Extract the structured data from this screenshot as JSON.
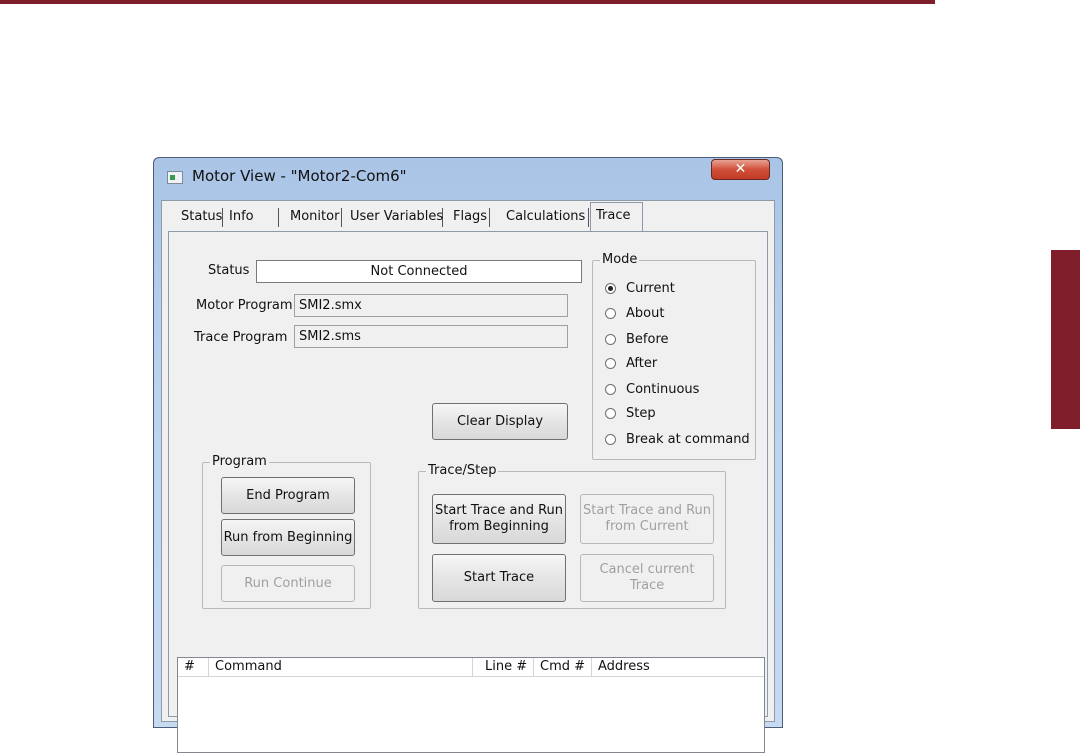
{
  "window": {
    "title": "Motor View - \"Motor2-Com6\"",
    "close_glyph": "✕"
  },
  "tabs": [
    {
      "label": "Status"
    },
    {
      "label": "Info"
    },
    {
      "label": "Monitor"
    },
    {
      "label": "User Variables"
    },
    {
      "label": "Flags"
    },
    {
      "label": "Calculations"
    },
    {
      "label": "Trace",
      "active": true
    }
  ],
  "status": {
    "label": "Status",
    "value": "Not Connected"
  },
  "motor_program": {
    "label": "Motor Program",
    "value": "SMI2.smx"
  },
  "trace_program": {
    "label": "Trace Program",
    "value": "SMI2.sms"
  },
  "clear_display_label": "Clear Display",
  "mode": {
    "title": "Mode",
    "selected": "Current",
    "options": [
      "Current",
      "About",
      "Before",
      "After",
      "Continuous",
      "Step",
      "Break at command"
    ]
  },
  "program_group": {
    "title": "Program",
    "end_program": "End Program",
    "run_from_beginning": "Run from Beginning",
    "run_continue": "Run Continue"
  },
  "trace_step": {
    "title": "Trace/Step",
    "start_trace_run_beginning": "Start Trace and Run from Beginning",
    "start_trace_run_current": "Start Trace and Run from Current",
    "start_trace": "Start Trace",
    "cancel_current_trace": "Cancel current Trace"
  },
  "trace_list": {
    "columns": [
      "#",
      "Command",
      "Line #",
      "Cmd #",
      "Address"
    ]
  },
  "colors": {
    "accent": "#7f1d2b",
    "window_frame": "#bcd3ef",
    "close_button": "#c8442d"
  },
  "icons": {
    "app": "app-window-icon",
    "close": "close-icon"
  }
}
